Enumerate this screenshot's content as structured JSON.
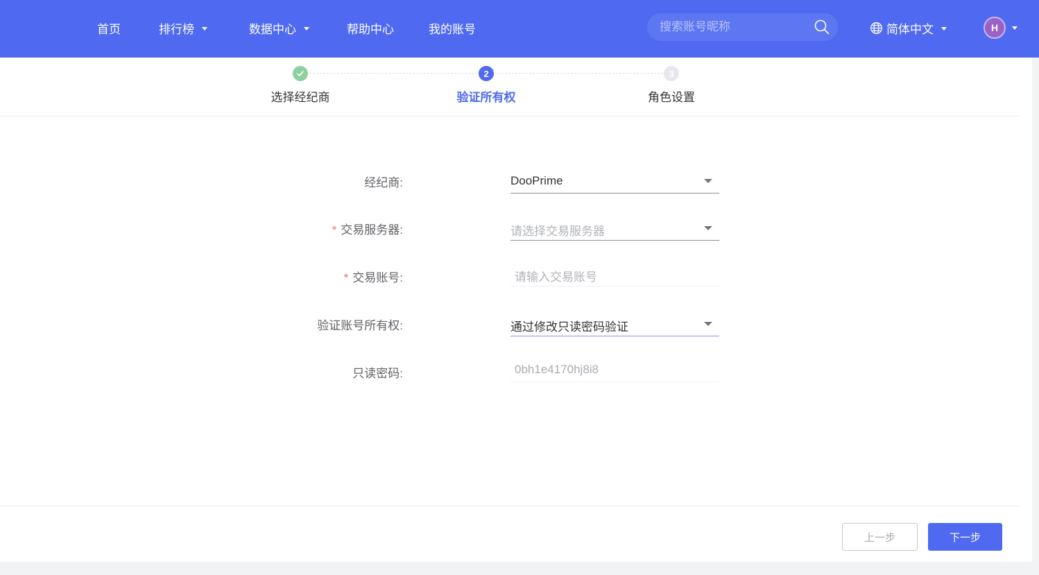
{
  "nav": {
    "items": [
      {
        "label": "首页",
        "has_dropdown": false
      },
      {
        "label": "排行榜",
        "has_dropdown": true
      },
      {
        "label": "数据中心",
        "has_dropdown": true
      },
      {
        "label": "帮助中心",
        "has_dropdown": false
      },
      {
        "label": "我的账号",
        "has_dropdown": false
      }
    ],
    "search_placeholder": "搜索账号昵称",
    "language": "简体中文",
    "avatar_initial": "H",
    "brand_color": "#4f6af0"
  },
  "steps": [
    {
      "label": "选择经纪商",
      "state": "done",
      "number": "1"
    },
    {
      "label": "验证所有权",
      "state": "active",
      "number": "2"
    },
    {
      "label": "角色设置",
      "state": "pending",
      "number": "3"
    }
  ],
  "form": {
    "broker": {
      "label": "经纪商:",
      "value": "DooPrime"
    },
    "server": {
      "label": "交易服务器:",
      "required": "*",
      "placeholder": "请选择交易服务器"
    },
    "account": {
      "label": "交易账号:",
      "required": "*",
      "placeholder": "请输入交易账号"
    },
    "verify_method": {
      "label": "验证账号所有权:",
      "value": "通过修改只读密码验证"
    },
    "readonly_password": {
      "label": "只读密码:",
      "value": "0bh1e4170hj8i8"
    }
  },
  "buttons": {
    "prev": "上一步",
    "next": "下一步"
  }
}
